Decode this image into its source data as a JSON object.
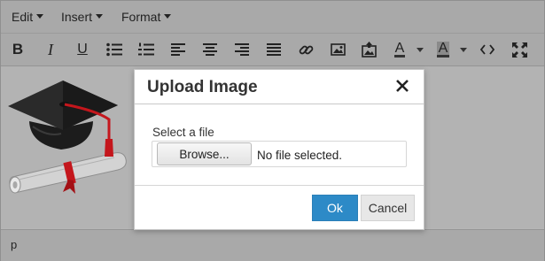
{
  "menubar": {
    "items": [
      {
        "label": "Edit"
      },
      {
        "label": "Insert"
      },
      {
        "label": "Format"
      }
    ]
  },
  "toolbar": {
    "buttons": [
      {
        "icon": "bold-icon",
        "glyph": "B"
      },
      {
        "icon": "italic-icon",
        "glyph": "I"
      },
      {
        "icon": "underline-icon",
        "glyph": "U"
      },
      {
        "icon": "bullet-list-icon"
      },
      {
        "icon": "numbered-list-icon"
      },
      {
        "icon": "align-left-icon"
      },
      {
        "icon": "align-center-icon"
      },
      {
        "icon": "align-right-icon"
      },
      {
        "icon": "align-justify-icon"
      },
      {
        "icon": "link-icon"
      },
      {
        "icon": "image-icon"
      },
      {
        "icon": "upload-image-icon"
      },
      {
        "icon": "text-color-icon",
        "glyph": "A"
      },
      {
        "icon": "background-color-icon",
        "glyph": "A"
      },
      {
        "icon": "source-code-icon"
      },
      {
        "icon": "fullscreen-icon"
      }
    ]
  },
  "content": {
    "image": "graduation-cap-and-diploma"
  },
  "statusbar": {
    "path": "p"
  },
  "dialog": {
    "title": "Upload Image",
    "file_label": "Select a file",
    "browse_label": "Browse...",
    "file_status": "No file selected.",
    "ok_label": "Ok",
    "cancel_label": "Cancel"
  },
  "colors": {
    "overlay_gray": "#b3b3b3",
    "primary_button": "#2d8ac7",
    "cap_red": "#c4161c"
  }
}
